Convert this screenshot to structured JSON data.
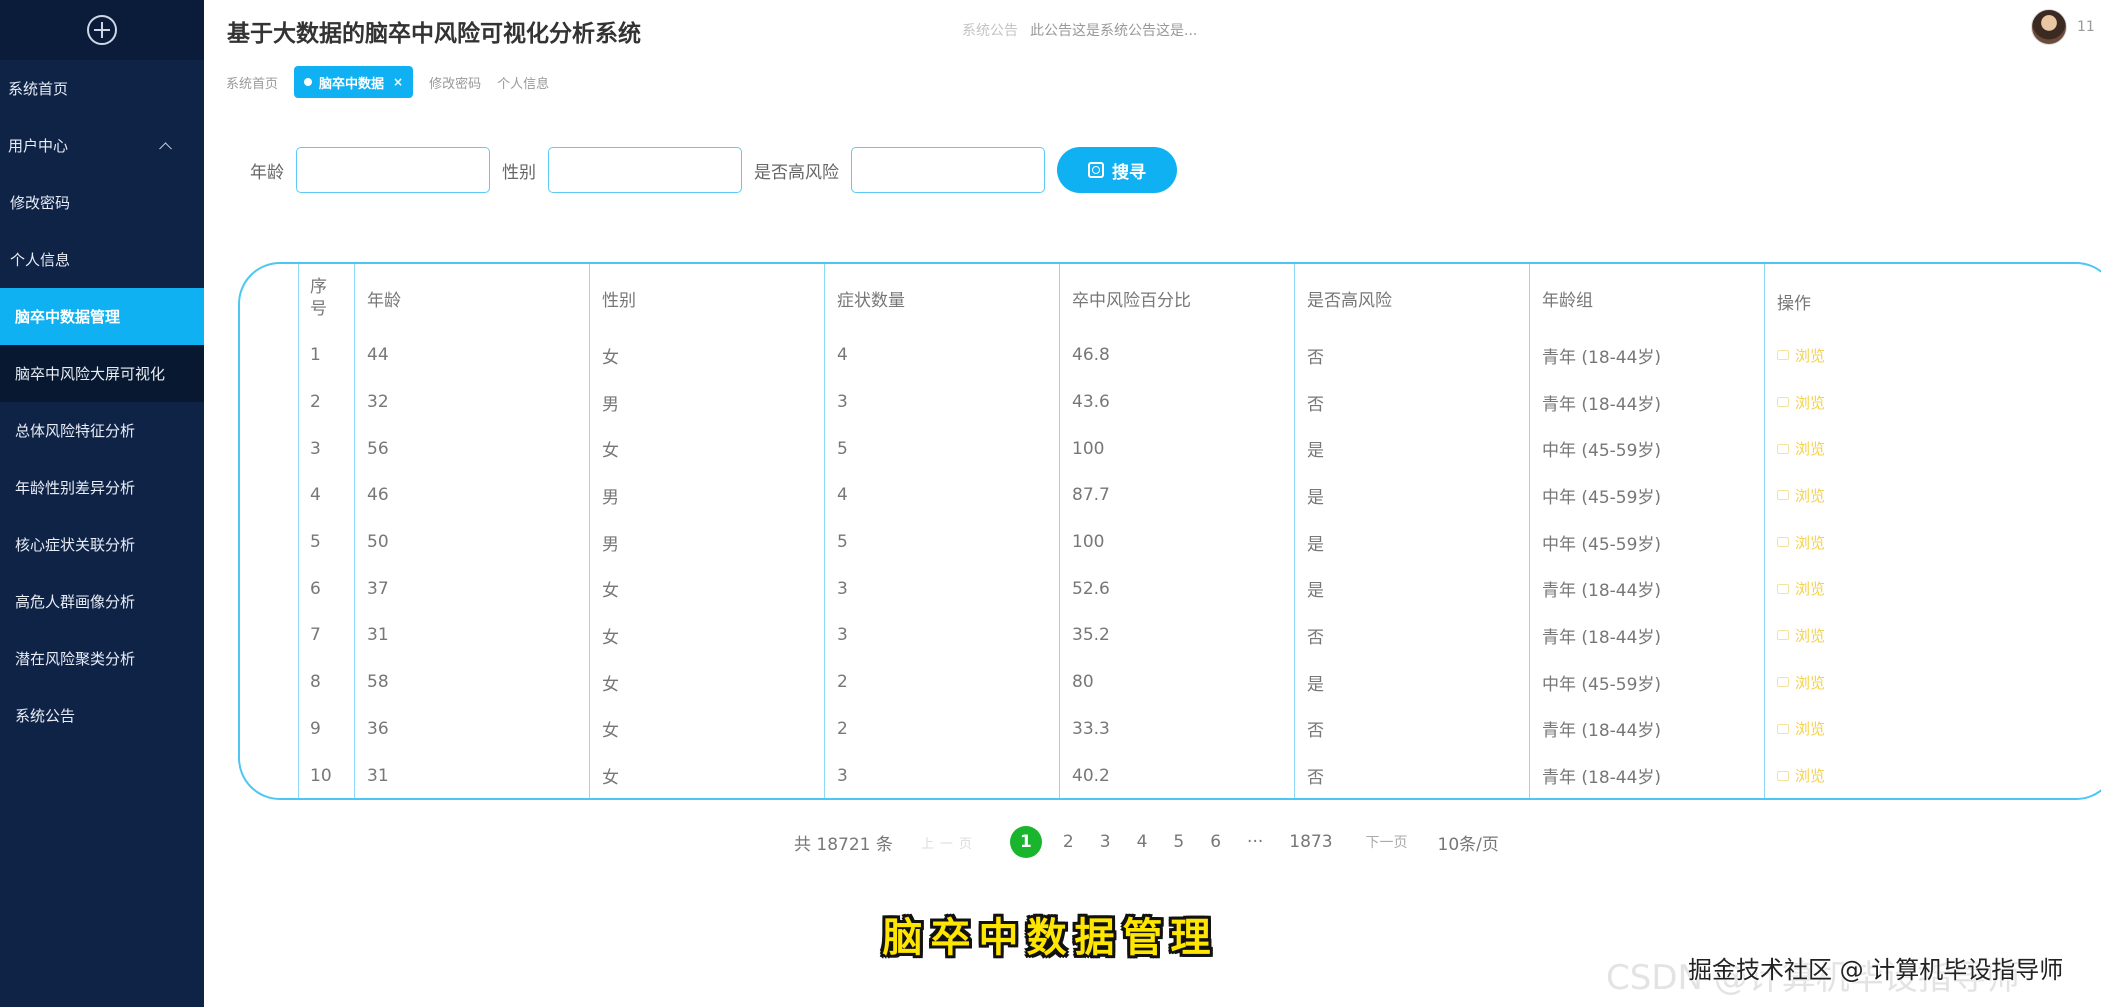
{
  "sidebar": {
    "top_icon": "plus-circle-icon",
    "items": [
      {
        "label": "系统首页"
      },
      {
        "label": "用户中心"
      },
      {
        "label": "修改密码"
      },
      {
        "label": "个人信息"
      },
      {
        "label": "脑卒中数据管理"
      },
      {
        "label": "脑卒中风险大屏可视化"
      },
      {
        "label": "总体风险特征分析"
      },
      {
        "label": "年龄性别差异分析"
      },
      {
        "label": "核心症状关联分析"
      },
      {
        "label": "高危人群画像分析"
      },
      {
        "label": "潜在风险聚类分析"
      },
      {
        "label": "系统公告"
      }
    ]
  },
  "header": {
    "title": "基于大数据的脑卒中风险可视化分析系统",
    "notice_title": "系统公告",
    "notice_text": "此公告这是系统公告这是...",
    "user_name": "11"
  },
  "tabs": [
    {
      "label": "系统首页"
    },
    {
      "label": "脑卒中数据",
      "close": "×"
    },
    {
      "label": "修改密码"
    },
    {
      "label": "个人信息"
    }
  ],
  "search": {
    "age_label": "年龄",
    "gender_label": "性别",
    "risk_label": "是否高风险",
    "age_value": "",
    "gender_value": "",
    "risk_value": "",
    "button_label": "搜寻"
  },
  "table": {
    "headers": [
      "序号",
      "年龄",
      "性别",
      "症状数量",
      "卒中风险百分比",
      "是否高风险",
      "年龄组",
      "操作"
    ],
    "rows": [
      {
        "idx": "1",
        "age": "44",
        "gender": "女",
        "symptoms": "4",
        "risk_pct": "46.8",
        "high_risk": "否",
        "age_group": "青年 (18-44岁)",
        "op": "浏览"
      },
      {
        "idx": "2",
        "age": "32",
        "gender": "男",
        "symptoms": "3",
        "risk_pct": "43.6",
        "high_risk": "否",
        "age_group": "青年 (18-44岁)",
        "op": "浏览"
      },
      {
        "idx": "3",
        "age": "56",
        "gender": "女",
        "symptoms": "5",
        "risk_pct": "100",
        "high_risk": "是",
        "age_group": "中年 (45-59岁)",
        "op": "浏览"
      },
      {
        "idx": "4",
        "age": "46",
        "gender": "男",
        "symptoms": "4",
        "risk_pct": "87.7",
        "high_risk": "是",
        "age_group": "中年 (45-59岁)",
        "op": "浏览"
      },
      {
        "idx": "5",
        "age": "50",
        "gender": "男",
        "symptoms": "5",
        "risk_pct": "100",
        "high_risk": "是",
        "age_group": "中年 (45-59岁)",
        "op": "浏览"
      },
      {
        "idx": "6",
        "age": "37",
        "gender": "女",
        "symptoms": "3",
        "risk_pct": "52.6",
        "high_risk": "是",
        "age_group": "青年 (18-44岁)",
        "op": "浏览"
      },
      {
        "idx": "7",
        "age": "31",
        "gender": "女",
        "symptoms": "3",
        "risk_pct": "35.2",
        "high_risk": "否",
        "age_group": "青年 (18-44岁)",
        "op": "浏览"
      },
      {
        "idx": "8",
        "age": "58",
        "gender": "女",
        "symptoms": "2",
        "risk_pct": "80",
        "high_risk": "是",
        "age_group": "中年 (45-59岁)",
        "op": "浏览"
      },
      {
        "idx": "9",
        "age": "36",
        "gender": "女",
        "symptoms": "2",
        "risk_pct": "33.3",
        "high_risk": "否",
        "age_group": "青年 (18-44岁)",
        "op": "浏览"
      },
      {
        "idx": "10",
        "age": "31",
        "gender": "女",
        "symptoms": "3",
        "risk_pct": "40.2",
        "high_risk": "否",
        "age_group": "青年 (18-44岁)",
        "op": "浏览"
      }
    ]
  },
  "pagination": {
    "total": "共 18721 条",
    "prev": "上一页",
    "pages": [
      "1",
      "2",
      "3",
      "4",
      "5",
      "6",
      "···",
      "1873"
    ],
    "current": "1",
    "next": "下一页",
    "page_size": "10条/页"
  },
  "overlay": {
    "subtitle": "脑卒中数据管理",
    "watermark_back": "CSDN @计算机毕设指导师",
    "watermark_front": "掘金技术社区 @ 计算机毕设指导师"
  },
  "colors": {
    "sidebar_bg": "#0f2347",
    "accent": "#0fb1f2",
    "current_page": "#19b52c",
    "action_link": "#f6d24a"
  }
}
